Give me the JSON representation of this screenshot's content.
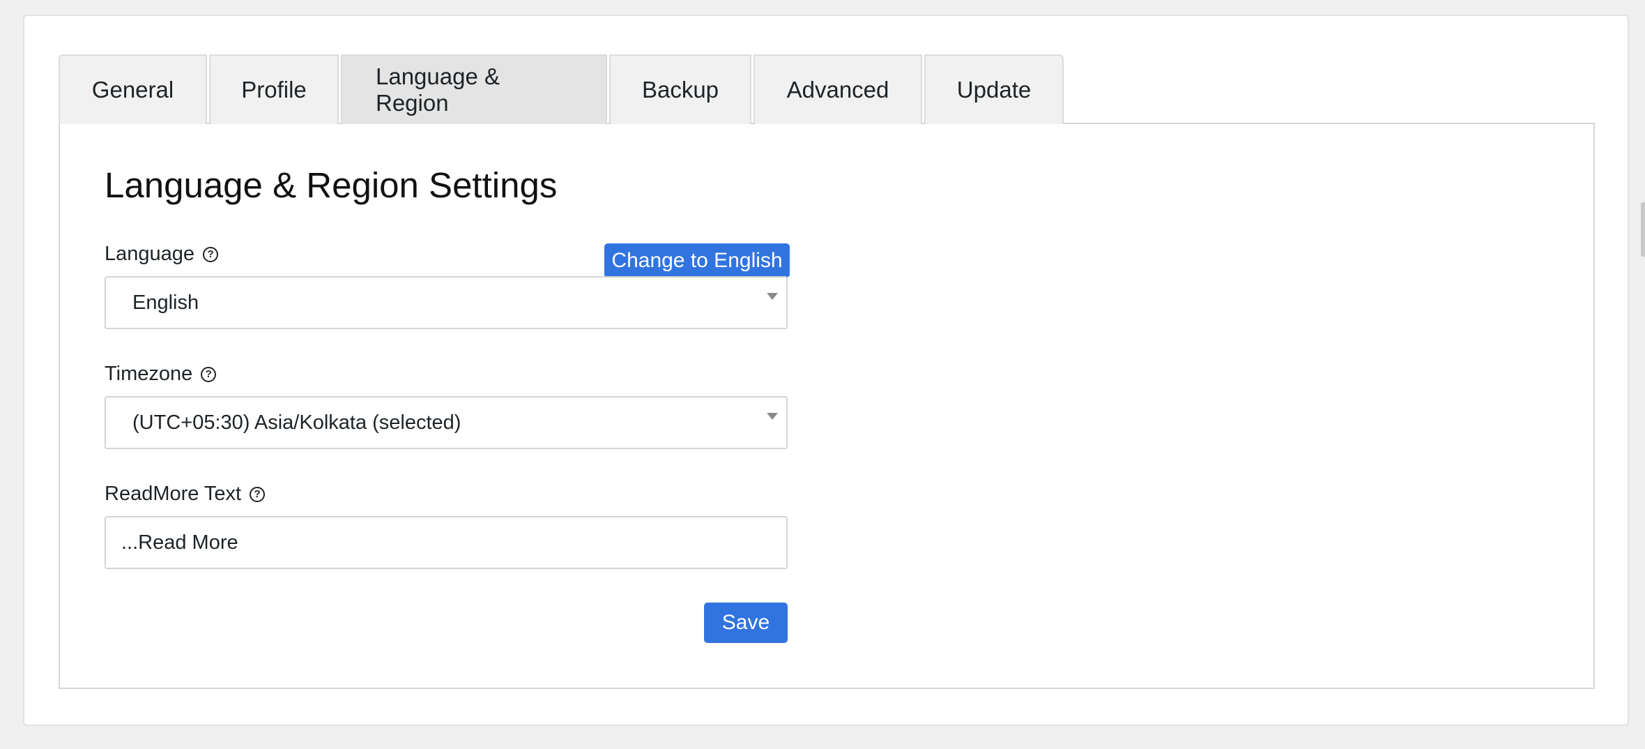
{
  "tabs": [
    {
      "label": "General"
    },
    {
      "label": "Profile"
    },
    {
      "label": "Language & Region"
    },
    {
      "label": "Backup"
    },
    {
      "label": "Advanced"
    },
    {
      "label": "Update"
    }
  ],
  "active_tab": "Language & Region",
  "panel": {
    "title": "Language & Region Settings",
    "language": {
      "label": "Language",
      "value": "English",
      "change_button": "Change to English"
    },
    "timezone": {
      "label": "Timezone",
      "value": "(UTC+05:30) Asia/Kolkata (selected)"
    },
    "readmore": {
      "label": "ReadMore Text",
      "value": "...Read More"
    },
    "save_label": "Save"
  },
  "icons": {
    "help": "question-circle-icon",
    "dropdown": "caret-down-icon"
  },
  "colors": {
    "primary_button": "#3174e0",
    "active_tab_bg": "#e4e4e4",
    "tab_bg": "#f1f1f1"
  }
}
